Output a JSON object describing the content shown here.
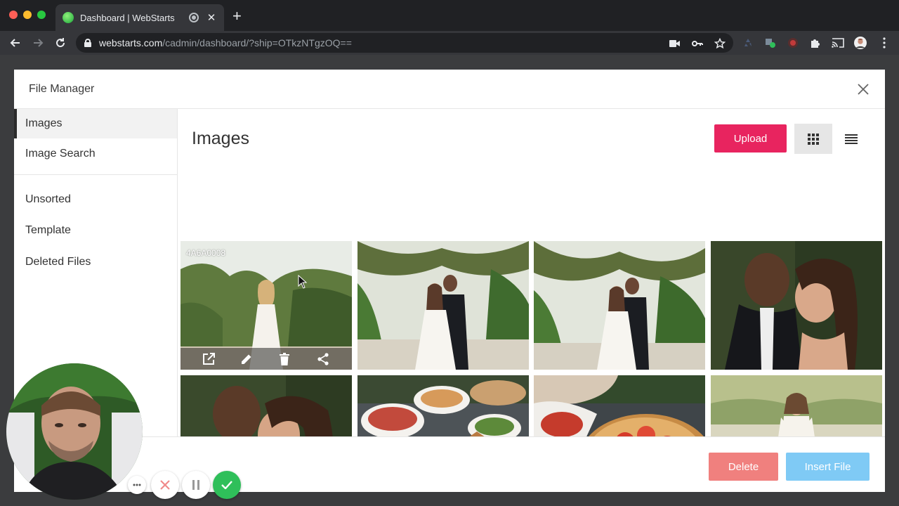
{
  "browser": {
    "tab_title": "Dashboard | WebStarts",
    "tab_close": "✕",
    "new_tab": "+",
    "url_host": "webstarts.com",
    "url_path": "/cadmin/dashboard/?ship=OTkzNTgzOQ=="
  },
  "modal": {
    "title": "File Manager",
    "close_icon": "close-icon"
  },
  "sidebar": {
    "items": [
      {
        "label": "Images",
        "active": true
      },
      {
        "label": "Image Search",
        "active": false
      },
      {
        "label": "Unsorted",
        "active": false
      },
      {
        "label": "Template",
        "active": false
      },
      {
        "label": "Deleted Files",
        "active": false
      }
    ]
  },
  "content": {
    "title": "Images",
    "upload_label": "Upload",
    "view_mode": "grid",
    "images": [
      {
        "name": "4A6A0008",
        "subject": "bride-in-garden",
        "hovered": true
      },
      {
        "subject": "couple-under-trees"
      },
      {
        "subject": "couple-under-trees-wide"
      },
      {
        "subject": "couple-close-up"
      },
      {
        "subject": "couple-kiss"
      },
      {
        "subject": "catering-platters"
      },
      {
        "subject": "caprese-platter"
      },
      {
        "subject": "bride-in-field"
      }
    ],
    "hover_actions": [
      "open-external-icon",
      "edit-icon",
      "delete-icon",
      "share-icon"
    ]
  },
  "footer": {
    "delete_label": "Delete",
    "insert_label": "Insert File"
  },
  "colors": {
    "upload": "#e8245f",
    "delete": "#f0807e",
    "insert": "#7fcaf5",
    "confirm": "#2fbf5a"
  }
}
